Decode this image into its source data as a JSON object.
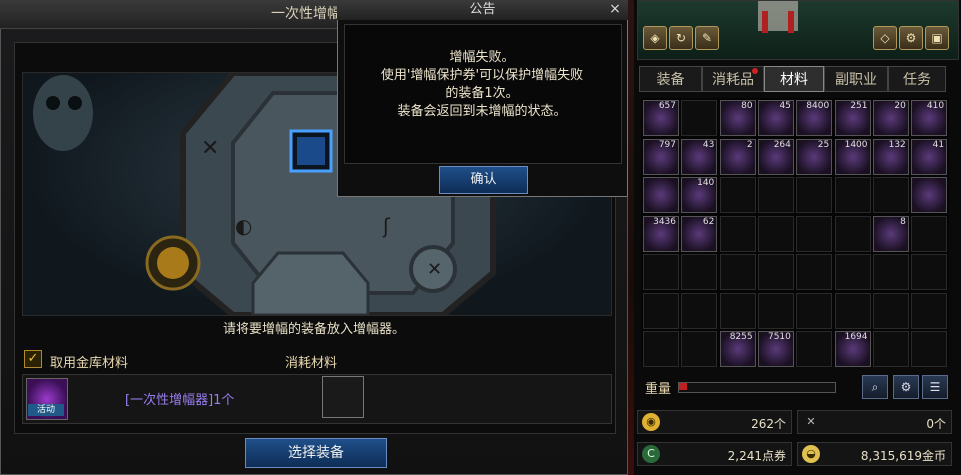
{
  "enhance_window": {
    "title": "一次性增幅器",
    "instruction": "请将要增幅的装备放入增幅器。",
    "use_bank_materials_label": "取用金库材料",
    "use_bank_materials_checked": true,
    "consume_materials_header": "消耗材料",
    "enhancer_item_text": "[一次性增幅器]1个",
    "enhancer_badge": "活动",
    "select_equipment_button": "选择装备"
  },
  "notice_dialog": {
    "title": "公告",
    "close": "×",
    "lines": [
      "增幅失败。",
      "使用'增幅保护券'可以保护增幅失败",
      "的装备1次。",
      "装备会返回到未增幅的状态。"
    ],
    "confirm_button": "确认"
  },
  "inventory": {
    "tabs": [
      "装备",
      "消耗品",
      "材料",
      "副职业",
      "任务"
    ],
    "active_tab": "材料",
    "grid_counts": [
      [
        "657",
        "",
        "80",
        "45",
        "8400",
        "251",
        "20",
        "410"
      ],
      [
        "797",
        "43",
        "2",
        "264",
        "25",
        "1400",
        "132",
        "41"
      ],
      [
        "",
        "140",
        "",
        "",
        "",
        "",
        "",
        ""
      ],
      [
        "3436",
        "62",
        "",
        "",
        "",
        "",
        "8",
        ""
      ],
      [
        "",
        "",
        "",
        "",
        "",
        "",
        "",
        ""
      ],
      [
        "",
        "",
        "",
        "",
        "",
        "",
        "",
        ""
      ],
      [
        "",
        "",
        "8255",
        "7510",
        "",
        "1694",
        "",
        ""
      ]
    ],
    "weight_label": "重量",
    "weight_fraction": 0.05,
    "currency": [
      {
        "icon": "coin-icon",
        "value": "262个",
        "color": "#e0b030"
      },
      {
        "icon": "crossed-swords-icon",
        "value": "0个",
        "color": "#aaaaaa"
      },
      {
        "icon": "point-icon",
        "value": "2,241点券",
        "color": "#40a060"
      },
      {
        "icon": "gold-icon",
        "value": "8,315,619金币",
        "color": "#e0c050"
      }
    ]
  }
}
